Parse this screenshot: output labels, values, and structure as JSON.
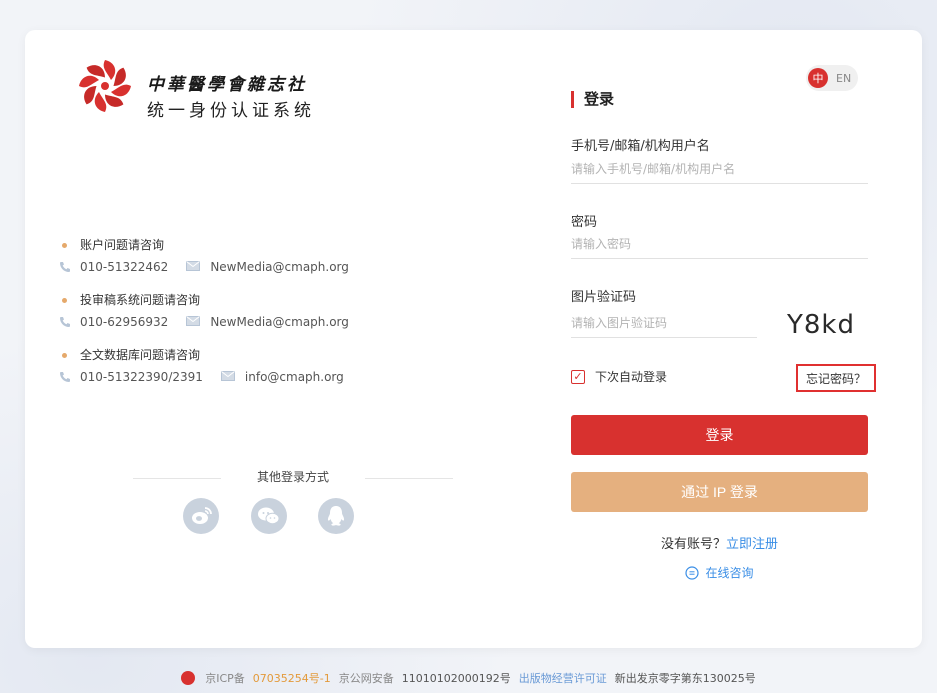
{
  "logo": {
    "title_line1": "中華醫學會雜志社",
    "title_line2": "统一身份认证系统"
  },
  "contacts": [
    {
      "title": "账户问题请咨询",
      "phone": "010-51322462",
      "email": "NewMedia@cmaph.org"
    },
    {
      "title": "投审稿系统问题请咨询",
      "phone": "010-62956932",
      "email": "NewMedia@cmaph.org"
    },
    {
      "title": "全文数据库问题请咨询",
      "phone": "010-51322390/2391",
      "email": "info@cmaph.org"
    }
  ],
  "other_login": {
    "title": "其他登录方式",
    "methods": [
      "weibo-icon",
      "wechat-icon",
      "qq-icon"
    ]
  },
  "lang": {
    "zh": "中",
    "en": "EN"
  },
  "login": {
    "title": "登录",
    "username_label": "手机号/邮箱/机构用户名",
    "username_placeholder": "请输入手机号/邮箱/机构用户名",
    "password_label": "密码",
    "password_placeholder": "请输入密码",
    "captcha_label": "图片验证码",
    "captcha_placeholder": "请输入图片验证码",
    "captcha_text": "Y8kd",
    "remember_label": "下次自动登录",
    "forgot_label": "忘记密码？",
    "submit_label": "登录",
    "ip_login_label": "通过 IP 登录",
    "no_account": "没有账号？",
    "register_link": "立即注册",
    "consult": "在线咨询"
  },
  "footer": {
    "icp_label": "京ICP备",
    "icp_number": "07035254号-1",
    "police_label": "京公网安备",
    "police_number": "11010102000192号",
    "publish_label": "出版物经营许可证",
    "publish_number": "新出发京零字第东130025号"
  },
  "colors": {
    "primary_red": "#d8312f",
    "ip_button": "#e5b07f",
    "link_blue": "#3a8ee6",
    "bullet": "#e5a96b"
  }
}
